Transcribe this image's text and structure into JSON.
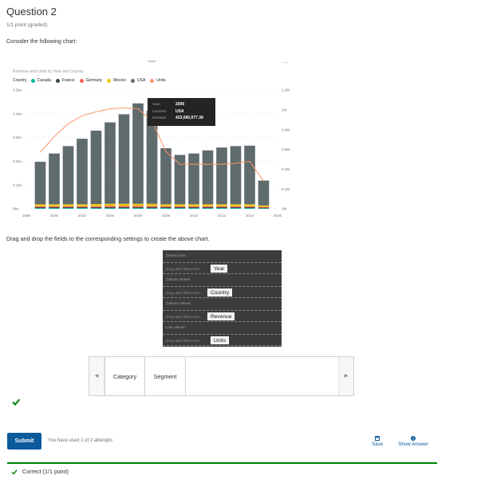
{
  "question": {
    "title": "Question 2",
    "points": "1/1 point (graded)",
    "prompt": "Consider the following chart:",
    "instruction": "Drag and drop the fields to the corresponding settings to create the above chart."
  },
  "chart_data": {
    "type": "bar",
    "title": "Revenue and Units by Year and Country",
    "legend_title": "Country",
    "legend_placement": "top-left",
    "legend": [
      {
        "name": "Canada",
        "color": "#01B8AA"
      },
      {
        "name": "France",
        "color": "#374649"
      },
      {
        "name": "Germany",
        "color": "#FD625E"
      },
      {
        "name": "Mexico",
        "color": "#F2C80F"
      },
      {
        "name": "USA",
        "color": "#5F6B6D"
      },
      {
        "name": "Units",
        "color": "#FE9666"
      }
    ],
    "more_options_label": "...",
    "x_ticks": [
      "1998",
      "2000",
      "2002",
      "2004",
      "2006",
      "2008",
      "2010",
      "2012",
      "2014",
      "2016"
    ],
    "y_left_ticks": [
      "0bn",
      "0.1bn",
      "0.2bn",
      "0.3bn",
      "0.4bn",
      "0.5bn"
    ],
    "y_right_ticks": [
      "0M",
      "0.2M",
      "0.4M",
      "0.6M",
      "0.8M",
      "1M",
      "1.2M"
    ],
    "y_left_range": [
      0,
      0.5
    ],
    "y_right_range": [
      0,
      1.2
    ],
    "years": [
      1999,
      2000,
      2001,
      2002,
      2003,
      2004,
      2005,
      2006,
      2007,
      2008,
      2009,
      2010,
      2011,
      2012,
      2013,
      2014,
      2015
    ],
    "series": [
      {
        "name": "USA",
        "color": "#5F6B6D",
        "values": [
          0.179,
          0.214,
          0.245,
          0.276,
          0.309,
          0.343,
          0.377,
          0.423,
          0.392,
          0.236,
          0.208,
          0.214,
          0.227,
          0.239,
          0.245,
          0.247,
          0.105
        ]
      },
      {
        "name": "Mexico",
        "color": "#F2C80F",
        "values": [
          0.008,
          0.008,
          0.008,
          0.008,
          0.009,
          0.009,
          0.009,
          0.009,
          0.009,
          0.008,
          0.008,
          0.008,
          0.008,
          0.008,
          0.008,
          0.008,
          0.006
        ]
      },
      {
        "name": "Germany",
        "color": "#FD625E",
        "values": [
          0.004,
          0.004,
          0.004,
          0.004,
          0.004,
          0.005,
          0.005,
          0.005,
          0.005,
          0.004,
          0.004,
          0.004,
          0.004,
          0.004,
          0.004,
          0.004,
          0.003
        ]
      },
      {
        "name": "France",
        "color": "#374649",
        "values": [
          0.004,
          0.004,
          0.004,
          0.004,
          0.004,
          0.004,
          0.004,
          0.004,
          0.004,
          0.004,
          0.004,
          0.004,
          0.004,
          0.004,
          0.004,
          0.004,
          0.003
        ]
      },
      {
        "name": "Canada",
        "color": "#01B8AA",
        "values": [
          0.003,
          0.003,
          0.003,
          0.003,
          0.003,
          0.003,
          0.003,
          0.003,
          0.003,
          0.003,
          0.003,
          0.003,
          0.003,
          0.003,
          0.003,
          0.003,
          0.002
        ]
      }
    ],
    "line": {
      "name": "Units",
      "color": "#FE9666",
      "values": [
        0.57,
        0.73,
        0.86,
        0.94,
        0.98,
        1.01,
        1.02,
        1.01,
        0.89,
        0.58,
        0.45,
        0.45,
        0.45,
        0.45,
        0.46,
        0.48,
        0.28
      ]
    },
    "tooltip": {
      "year_label": "YEAR",
      "year_value": "2006",
      "country_label": "COUNTRY",
      "country_value": "USA",
      "revenue_label": "REVENUE",
      "revenue_value": "423,090,077.39"
    }
  },
  "drop_panel": {
    "rows": [
      {
        "label": "Shared Axis",
        "hint": "Drag data fields here",
        "chip": "Year"
      },
      {
        "label": "Column Series",
        "hint": "Drag data fields here",
        "chip": "Country"
      },
      {
        "label": "Column Values",
        "hint": "Drag data fields here",
        "chip": "Revenue"
      },
      {
        "label": "Line Values",
        "hint": "Drag data fields here",
        "chip": "Units"
      }
    ]
  },
  "carousel": {
    "items": [
      "Category",
      "Segment"
    ],
    "prev_icon": "triangle-left-icon",
    "next_icon": "triangle-right-icon"
  },
  "footer": {
    "submit_label": "Submit",
    "attempts_text": "You have used 1 of 2 attempts",
    "save_label": "Save",
    "show_answer_label": "Show Answer",
    "result_text": "Correct (1/1 point)",
    "success_color": "#008100",
    "accent_color": "#0A5A9C"
  }
}
